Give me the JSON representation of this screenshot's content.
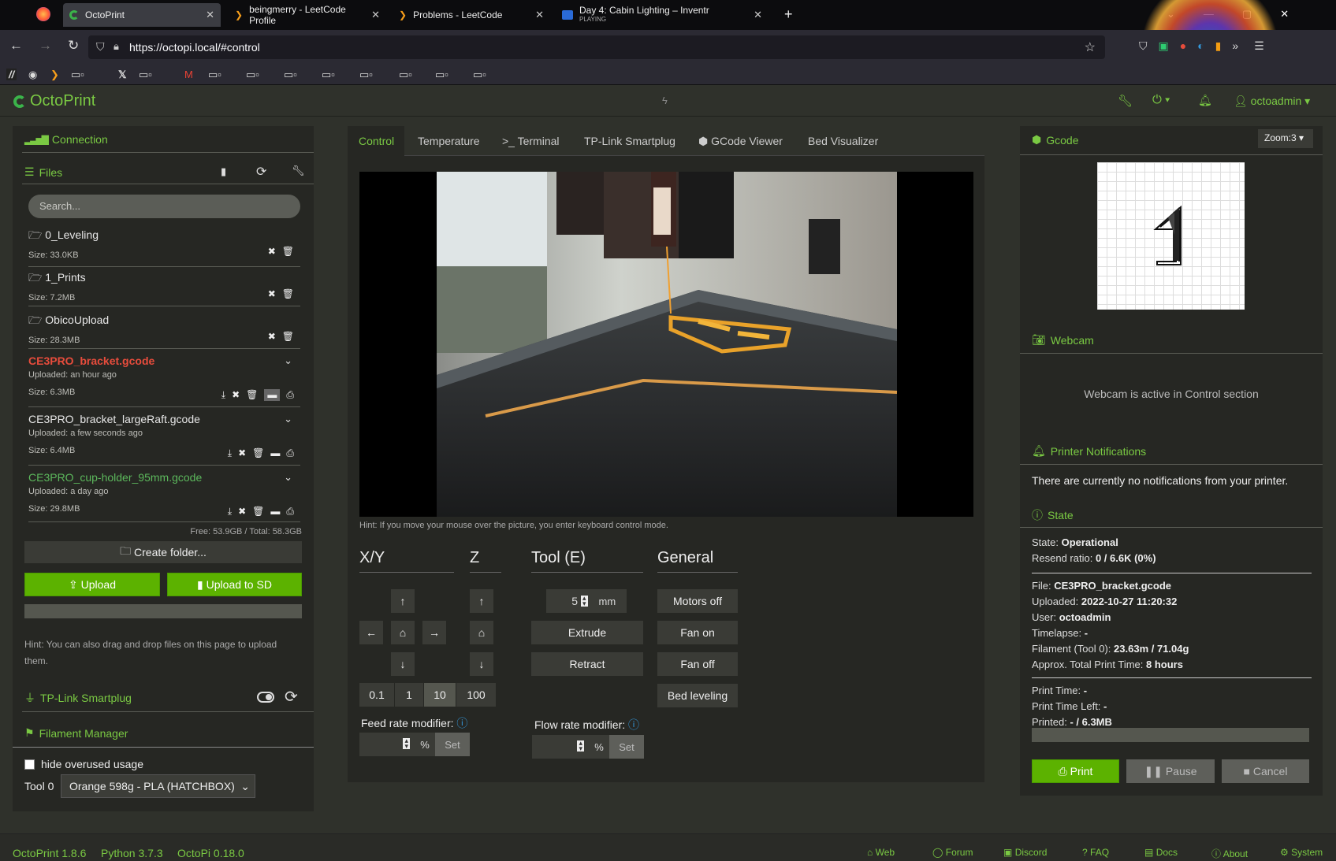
{
  "browser": {
    "tabs": [
      {
        "label": "OctoPrint"
      },
      {
        "label": "beingmerry - LeetCode Profile"
      },
      {
        "label": "Problems - LeetCode"
      },
      {
        "label": "Day 4: Cabin Lighting – Inventr",
        "sublabel": "PLAYING"
      }
    ],
    "url": "https://octopi.local/#control"
  },
  "navbar": {
    "brand": "OctoPrint",
    "user": "octoadmin"
  },
  "sidebar": {
    "connection_title": "Connection",
    "files_title": "Files",
    "search_placeholder": "Search...",
    "files": [
      {
        "name": "0_Leveling",
        "size": "Size: 33.0KB",
        "type": "folder"
      },
      {
        "name": "1_Prints",
        "size": "Size: 7.2MB",
        "type": "folder"
      },
      {
        "name": "ObicoUpload",
        "size": "Size: 28.3MB",
        "type": "folder"
      },
      {
        "name": "CE3PRO_bracket.gcode",
        "uploaded": "Uploaded: an hour ago",
        "size": "Size: 6.3MB",
        "type": "file",
        "color": "#e74c3c"
      },
      {
        "name": "CE3PRO_bracket_largeRaft.gcode",
        "uploaded": "Uploaded: a few seconds ago",
        "size": "Size: 6.4MB",
        "type": "file",
        "color": "#e6e6e6"
      },
      {
        "name": "CE3PRO_cup-holder_95mm.gcode",
        "uploaded": "Uploaded: a day ago",
        "size": "Size: 29.8MB",
        "type": "file",
        "color": "#5cb85c"
      }
    ],
    "free_space": "Free: 53.9GB / Total: 58.3GB",
    "create_folder": "Create folder...",
    "upload": "Upload",
    "upload_sd": "Upload to SD",
    "hint": "Hint: You can also drag and drop files on this page to upload them.",
    "smartplug_title": "TP-Link Smartplug",
    "filament_title": "Filament Manager",
    "hide_overused": "hide overused usage",
    "tool_label": "Tool 0",
    "tool_select": "Orange 598g - PLA (HATCHBOX)"
  },
  "control": {
    "tabs": [
      "Control",
      "Temperature",
      "Terminal",
      "TP-Link Smartplug",
      "GCode Viewer",
      "Bed Visualizer"
    ],
    "webcam_hint": "Hint: If you move your mouse over the picture, you enter keyboard control mode.",
    "xy_title": "X/Y",
    "z_title": "Z",
    "tool_title": "Tool (E)",
    "general_title": "General",
    "steps": [
      "0.1",
      "1",
      "10",
      "100"
    ],
    "extrude_amount": "5",
    "unit_mm": "mm",
    "extrude": "Extrude",
    "retract": "Retract",
    "motors_off": "Motors off",
    "fan_on": "Fan on",
    "fan_off": "Fan off",
    "bed_leveling": "Bed leveling",
    "feed_rate": "Feed rate modifier:",
    "flow_rate": "Flow rate modifier:",
    "percent": "%",
    "set": "Set"
  },
  "right": {
    "gcode_title": "Gcode",
    "zoom": "Zoom:3",
    "webcam_title": "Webcam",
    "webcam_msg": "Webcam is active in Control section",
    "notif_title": "Printer Notifications",
    "notif_msg": "There are currently no notifications from your printer.",
    "state_title": "State",
    "state_label": "State:",
    "state_value": "Operational",
    "resend_label": "Resend ratio:",
    "resend_value": "0 / 6.6K (0%)",
    "file_label": "File:",
    "file_value": "CE3PRO_bracket.gcode",
    "uploaded_label": "Uploaded:",
    "uploaded_value": "2022-10-27 11:20:32",
    "user_label": "User:",
    "user_value": "octoadmin",
    "timelapse_label": "Timelapse:",
    "timelapse_value": "-",
    "filament_label": "Filament (Tool 0):",
    "filament_value": "23.63m / 71.04g",
    "approx_label": "Approx. Total Print Time:",
    "approx_value": "8 hours",
    "printtime_label": "Print Time:",
    "printtime_value": "-",
    "timeleft_label": "Print Time Left:",
    "timeleft_value": "-",
    "printed_label": "Printed:",
    "printed_value": "- / 6.3MB",
    "print": "Print",
    "pause": "Pause",
    "cancel": "Cancel"
  },
  "footer": {
    "version": "OctoPrint 1.8.6",
    "python": "Python 3.7.3",
    "octopi": "OctoPi 0.18.0",
    "links": [
      "Web",
      "Forum",
      "Discord",
      "FAQ",
      "Docs",
      "About",
      "System"
    ]
  }
}
